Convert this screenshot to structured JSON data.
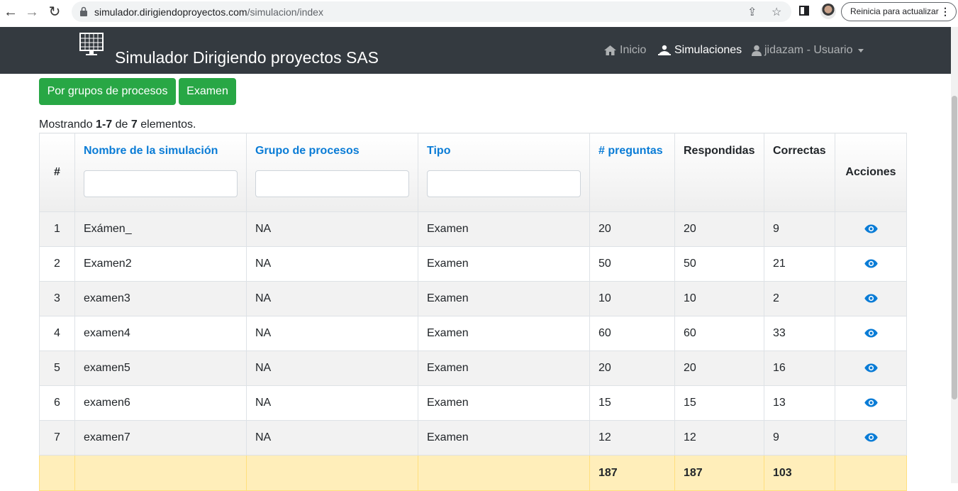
{
  "browser": {
    "url_host": "simulador.dirigiendoproyectos.com",
    "url_path": "/simulacion/index",
    "update_label": "Reinicia para actualizar"
  },
  "navbar": {
    "brand": "Simulador Dirigiendo proyectos SAS",
    "items": [
      {
        "label": "Inicio",
        "icon": "home-icon"
      },
      {
        "label": "Simulaciones",
        "icon": "users-icon"
      },
      {
        "label": "jidazam - Usuario",
        "icon": "user-icon"
      }
    ]
  },
  "buttons": {
    "by_groups": "Por grupos de procesos",
    "exam": "Examen"
  },
  "summary": {
    "prefix": "Mostrando",
    "range": "1-7",
    "of": "de",
    "total": "7",
    "suffix": "elementos."
  },
  "table": {
    "headers": [
      "#",
      "Nombre de la simulación",
      "Grupo de procesos",
      "Tipo",
      "# preguntas",
      "Respondidas",
      "Correctas",
      "Acciones"
    ],
    "rows": [
      [
        "1",
        "Exámen_",
        "NA",
        "Examen",
        "20",
        "20",
        "9"
      ],
      [
        "2",
        "Examen2",
        "NA",
        "Examen",
        "50",
        "50",
        "21"
      ],
      [
        "3",
        "examen3",
        "NA",
        "Examen",
        "10",
        "10",
        "2"
      ],
      [
        "4",
        "examen4",
        "NA",
        "Examen",
        "60",
        "60",
        "33"
      ],
      [
        "5",
        "examen5",
        "NA",
        "Examen",
        "20",
        "20",
        "16"
      ],
      [
        "6",
        "examen6",
        "NA",
        "Examen",
        "15",
        "15",
        "13"
      ],
      [
        "7",
        "examen7",
        "NA",
        "Examen",
        "12",
        "12",
        "9"
      ]
    ],
    "totals": {
      "preguntas": "187",
      "respondidas": "187",
      "correctas": "103"
    }
  },
  "colors": {
    "navbar": "#343a40",
    "success": "#28a745",
    "link": "#0a7cd6",
    "totals_row": "#ffeeba"
  }
}
